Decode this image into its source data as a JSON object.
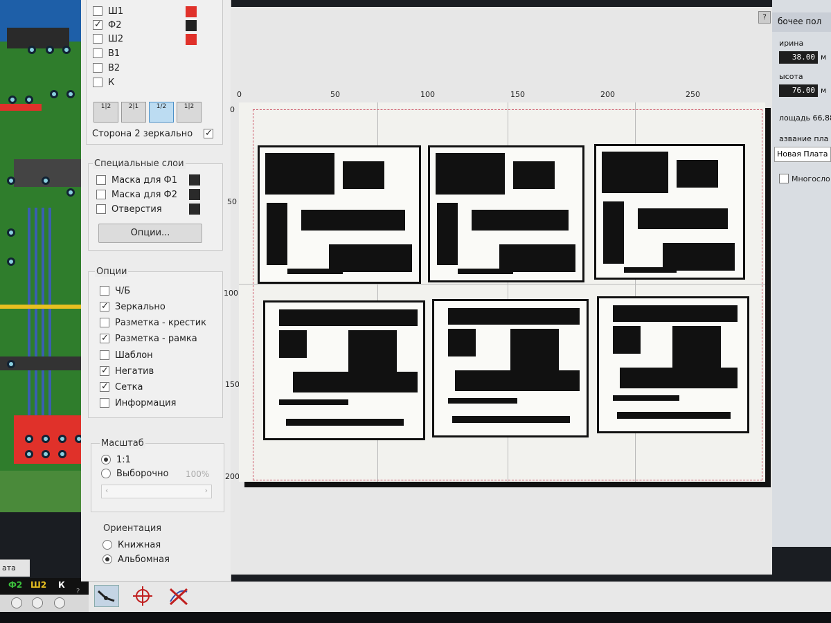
{
  "layers": {
    "items": [
      {
        "label": "Ш1",
        "checked": false,
        "color": "#e0312a"
      },
      {
        "label": "Ф2",
        "checked": true,
        "color": "#222222"
      },
      {
        "label": "Ш2",
        "checked": false,
        "color": "#e0312a"
      },
      {
        "label": "В1",
        "checked": false
      },
      {
        "label": "В2",
        "checked": false
      },
      {
        "label": "К",
        "checked": false
      }
    ],
    "side_buttons": [
      "1|2",
      "2|1",
      "1/2",
      "1|2"
    ],
    "mirror_side_label": "Сторона 2 зеркально"
  },
  "special_layers": {
    "title": "Специальные слои",
    "items": [
      {
        "label": "Маска для Ф1"
      },
      {
        "label": "Маска для Ф2"
      },
      {
        "label": "Отверстия"
      }
    ],
    "options_button": "Опции..."
  },
  "options": {
    "title": "Опции",
    "items": [
      {
        "label": "Ч/Б",
        "checked": false
      },
      {
        "label": "Зеркально",
        "checked": true
      },
      {
        "label": "Разметка - крестик",
        "checked": false
      },
      {
        "label": "Разметка - рамка",
        "checked": true
      },
      {
        "label": "Шаблон",
        "checked": false
      },
      {
        "label": "Негатив",
        "checked": true
      },
      {
        "label": "Сетка",
        "checked": true
      },
      {
        "label": "Информация",
        "checked": false
      }
    ]
  },
  "scale": {
    "title": "Масштаб",
    "options": [
      {
        "label": "1:1",
        "selected": true
      },
      {
        "label": "Выборочно",
        "selected": false
      }
    ],
    "custom_value": "100%"
  },
  "orientation": {
    "title": "Ориентация",
    "options": [
      {
        "label": "Книжная",
        "selected": false
      },
      {
        "label": "Альбомная",
        "selected": true
      }
    ]
  },
  "preview": {
    "help": "?",
    "ruler_top": [
      "0",
      "50",
      "100",
      "150",
      "200",
      "250"
    ],
    "ruler_left": [
      "0",
      "50",
      "100",
      "150",
      "200"
    ]
  },
  "editor": {
    "tab_label": "ата",
    "layer_tags": [
      "Ф2",
      "Ш2",
      "К"
    ],
    "help": "?"
  },
  "properties": {
    "header": "бочее пол",
    "width_label": "ирина",
    "width_value": "38.00",
    "height_label": "ысота",
    "height_value": "76.00",
    "unit": "м",
    "area_label": "лощадь 66,88",
    "name_label": "азвание пла",
    "name_value": "Новая Плата",
    "multilayer_label": "Многосло"
  },
  "colors": {
    "pcb_green": "#2f7d2c",
    "trace_blue": "#3a5fb0",
    "layer_red": "#e0312a",
    "frame_dashed": "#cc5566"
  }
}
